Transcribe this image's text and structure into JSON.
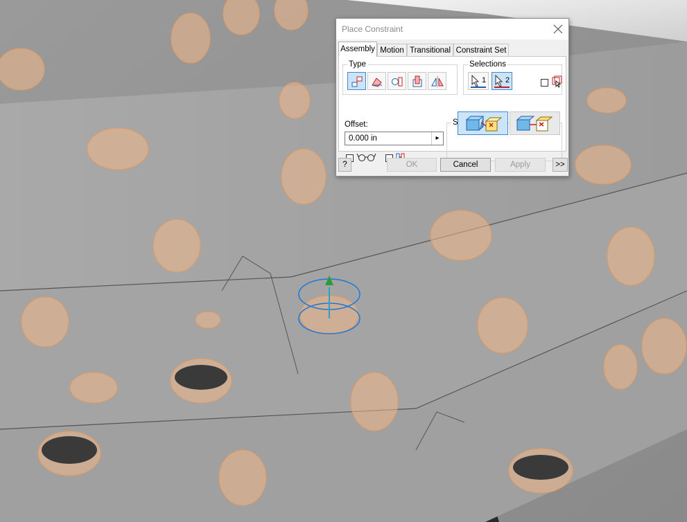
{
  "dialog": {
    "title": "Place Constraint",
    "tabs": [
      {
        "label": "Assembly",
        "active": true
      },
      {
        "label": "Motion",
        "active": false
      },
      {
        "label": "Transitional",
        "active": false
      },
      {
        "label": "Constraint Set",
        "active": false
      }
    ],
    "type_group": {
      "label": "Type",
      "buttons": [
        "mate-icon",
        "angle-icon",
        "tangent-icon",
        "insert-icon",
        "symmetry-icon"
      ],
      "selected": "mate-icon"
    },
    "selections_group": {
      "label": "Selections",
      "select1_label": "1",
      "select2_label": "2",
      "selected": "2",
      "first_occurrence_checked": false
    },
    "offset": {
      "label": "Offset:",
      "value": "0.000 in"
    },
    "show_preview_checked": false,
    "predict_offset_checked": false,
    "solution_group": {
      "label": "Solution",
      "options": [
        "mate-solution",
        "flush-solution"
      ],
      "selected": "mate-solution"
    },
    "buttons": {
      "help": "?",
      "ok": "OK",
      "cancel": "Cancel",
      "apply": "Apply",
      "expand": ">>"
    }
  },
  "colors": {
    "accent": "#3f8ad2",
    "selected_bg": "#cce4f7",
    "model_gray": "#a2a2a2",
    "hole_highlight": "#f0b88a"
  }
}
